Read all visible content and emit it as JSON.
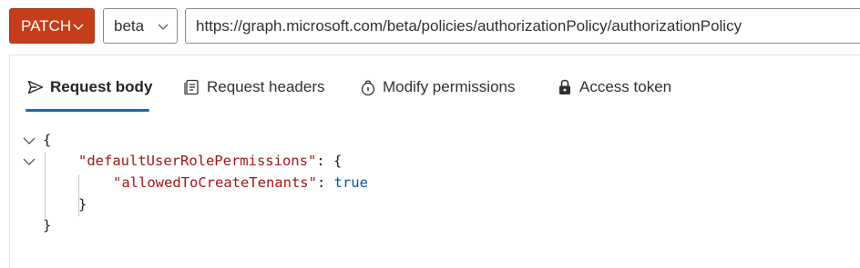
{
  "toolbar": {
    "method": "PATCH",
    "version": "beta",
    "url": "https://graph.microsoft.com/beta/policies/authorizationPolicy/authorizationPolicy"
  },
  "tabs": [
    {
      "label": "Request body",
      "icon": "send-icon",
      "active": true
    },
    {
      "label": "Request headers",
      "icon": "document-icon",
      "active": false
    },
    {
      "label": "Modify permissions",
      "icon": "shield-lock-icon",
      "active": false
    },
    {
      "label": "Access token",
      "icon": "lock-icon",
      "active": false
    }
  ],
  "editor": {
    "open_brace": "{",
    "key1": "\"defaultUserRolePermissions\"",
    "sep1": ": {",
    "key2": "\"allowedToCreateTenants\"",
    "sep2": ": ",
    "val2": "true",
    "close_inner": "}",
    "close_outer": "}"
  },
  "colors": {
    "accent": "#0f6cbd",
    "method_bg": "#c43e1c",
    "json_key": "#a31515",
    "json_value": "#0451a5"
  }
}
